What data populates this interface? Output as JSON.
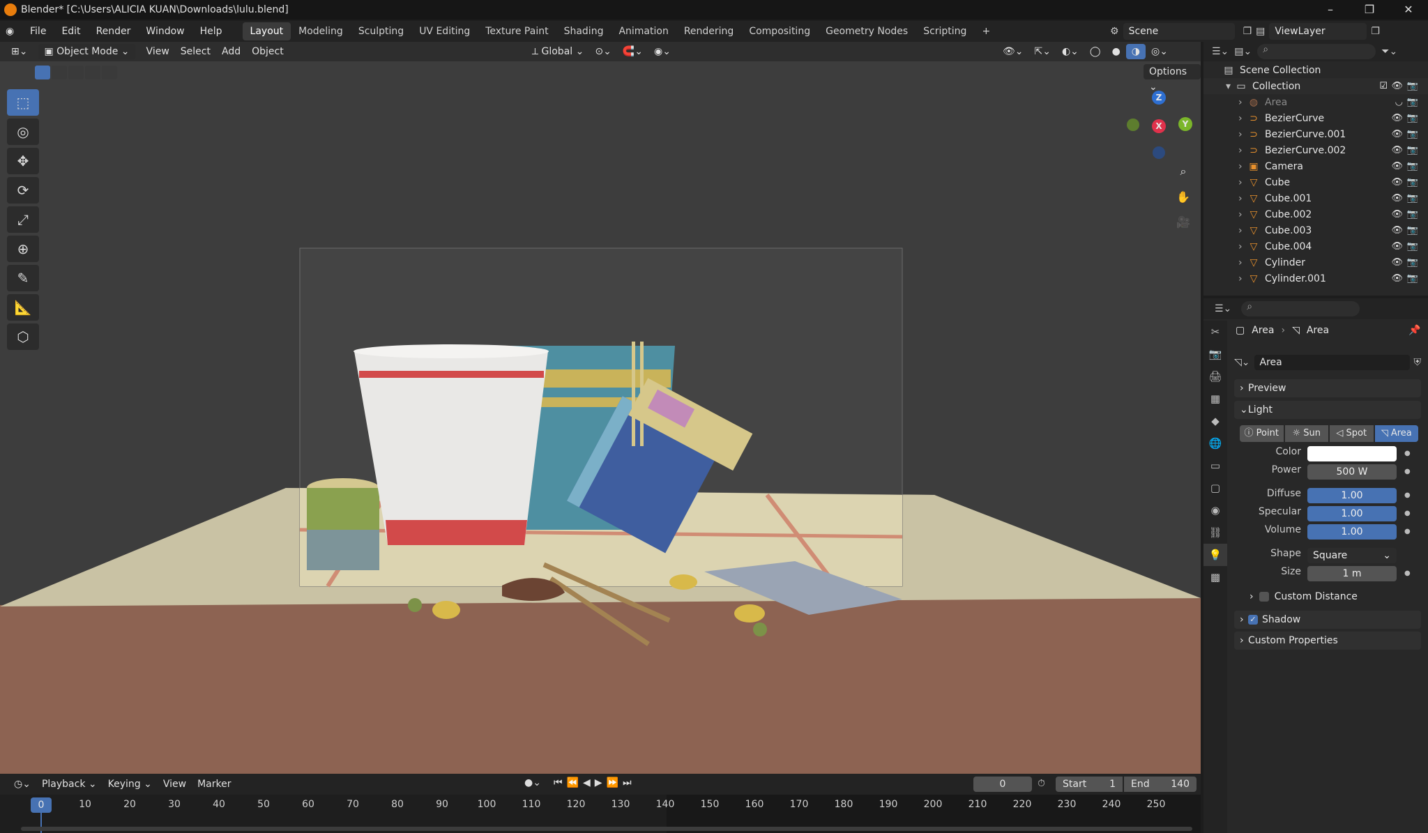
{
  "window": {
    "title": "Blender* [C:\\Users\\ALICIA KUAN\\Downloads\\lulu.blend]",
    "controls": [
      "–",
      "❐",
      "✕"
    ]
  },
  "menu": [
    "File",
    "Edit",
    "Render",
    "Window",
    "Help"
  ],
  "workspaces": [
    "Layout",
    "Modeling",
    "Sculpting",
    "UV Editing",
    "Texture Paint",
    "Shading",
    "Animation",
    "Rendering",
    "Compositing",
    "Geometry Nodes",
    "Scripting"
  ],
  "active_workspace": "Layout",
  "scene_name": "Scene",
  "view_layer": "ViewLayer",
  "viewport": {
    "mode": "Object Mode",
    "menus": [
      "View",
      "Select",
      "Add",
      "Object"
    ],
    "orientation": "Global",
    "options_label": "Options",
    "gizmo_axes": [
      "Z",
      "X",
      "Y"
    ]
  },
  "outliner": {
    "root": "Scene Collection",
    "collection": "Collection",
    "items": [
      "Area",
      "BezierCurve",
      "BezierCurve.001",
      "BezierCurve.002",
      "Camera",
      "Cube",
      "Cube.001",
      "Cube.002",
      "Cube.003",
      "Cube.004",
      "Cylinder",
      "Cylinder.001"
    ]
  },
  "properties": {
    "breadcrumb": [
      "Area",
      "Area"
    ],
    "data_name": "Area",
    "panels": {
      "preview": "Preview",
      "light": "Light",
      "custom_distance": "Custom Distance",
      "shadow": "Shadow",
      "custom_properties": "Custom Properties"
    },
    "light_types": [
      "Point",
      "Sun",
      "Spot",
      "Area"
    ],
    "active_light_type": "Area",
    "fields": {
      "color_label": "Color",
      "color_value": "#ffffff",
      "power_label": "Power",
      "power": "500 W",
      "diffuse_label": "Diffuse",
      "diffuse": "1.00",
      "specular_label": "Specular",
      "specular": "1.00",
      "volume_label": "Volume",
      "volume": "1.00",
      "shape_label": "Shape",
      "shape": "Square",
      "size_label": "Size",
      "size": "1 m"
    },
    "shadow_checked": true
  },
  "timeline": {
    "menus": [
      "Playback",
      "Keying",
      "View",
      "Marker"
    ],
    "current_frame": "0",
    "start_label": "Start",
    "start": "1",
    "end_label": "End",
    "end": "140",
    "ticks": [
      "0",
      "10",
      "20",
      "30",
      "40",
      "50",
      "60",
      "70",
      "80",
      "90",
      "100",
      "110",
      "120",
      "130",
      "140",
      "150",
      "160",
      "170",
      "180",
      "190",
      "200",
      "210",
      "220",
      "230",
      "240",
      "250"
    ]
  }
}
